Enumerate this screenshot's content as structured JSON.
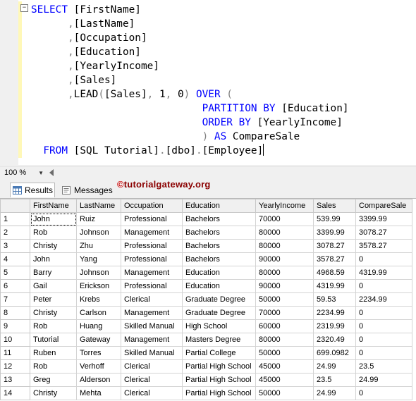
{
  "editor": {
    "collapse_glyph": "−",
    "lines": [
      [
        {
          "t": "SELECT ",
          "c": "kw"
        },
        {
          "t": "[FirstName]",
          "c": ""
        }
      ],
      [
        {
          "t": "      ",
          "c": ""
        },
        {
          "t": ",",
          "c": "gr"
        },
        {
          "t": "[LastName]",
          "c": ""
        }
      ],
      [
        {
          "t": "      ",
          "c": ""
        },
        {
          "t": ",",
          "c": "gr"
        },
        {
          "t": "[Occupation]",
          "c": ""
        }
      ],
      [
        {
          "t": "      ",
          "c": ""
        },
        {
          "t": ",",
          "c": "gr"
        },
        {
          "t": "[Education]",
          "c": ""
        }
      ],
      [
        {
          "t": "      ",
          "c": ""
        },
        {
          "t": ",",
          "c": "gr"
        },
        {
          "t": "[YearlyIncome]",
          "c": ""
        }
      ],
      [
        {
          "t": "      ",
          "c": ""
        },
        {
          "t": ",",
          "c": "gr"
        },
        {
          "t": "[Sales]",
          "c": ""
        }
      ],
      [
        {
          "t": "      ",
          "c": ""
        },
        {
          "t": ",",
          "c": "gr"
        },
        {
          "t": "LEAD",
          "c": ""
        },
        {
          "t": "(",
          "c": "gr"
        },
        {
          "t": "[Sales]",
          "c": ""
        },
        {
          "t": ", ",
          "c": "gr"
        },
        {
          "t": "1",
          "c": ""
        },
        {
          "t": ", ",
          "c": "gr"
        },
        {
          "t": "0",
          "c": ""
        },
        {
          "t": ") ",
          "c": "gr"
        },
        {
          "t": "OVER ",
          "c": "kw"
        },
        {
          "t": "(",
          "c": "gr"
        }
      ],
      [
        {
          "t": "                            ",
          "c": ""
        },
        {
          "t": "PARTITION BY ",
          "c": "kw"
        },
        {
          "t": "[Education]",
          "c": ""
        }
      ],
      [
        {
          "t": "                            ",
          "c": ""
        },
        {
          "t": "ORDER BY ",
          "c": "kw"
        },
        {
          "t": "[YearlyIncome]",
          "c": ""
        }
      ],
      [
        {
          "t": "                            ",
          "c": ""
        },
        {
          "t": ") ",
          "c": "gr"
        },
        {
          "t": "AS ",
          "c": "kw"
        },
        {
          "t": "CompareSale",
          "c": ""
        }
      ],
      [
        {
          "t": "  ",
          "c": ""
        },
        {
          "t": "FROM ",
          "c": "kw"
        },
        {
          "t": "[SQL Tutorial]",
          "c": ""
        },
        {
          "t": ".",
          "c": "gr"
        },
        {
          "t": "[dbo]",
          "c": ""
        },
        {
          "t": ".",
          "c": "gr"
        },
        {
          "t": "[Employee]",
          "c": ""
        }
      ]
    ]
  },
  "zoom": {
    "value": "100 %",
    "arrow": "▼"
  },
  "tabs": {
    "results": "Results",
    "messages": "Messages"
  },
  "watermark": {
    "symbol": "©",
    "text": "tutorialgateway.org"
  },
  "grid": {
    "columns": [
      "",
      "FirstName",
      "LastName",
      "Occupation",
      "Education",
      "YearlyIncome",
      "Sales",
      "CompareSale"
    ],
    "rows": [
      [
        "1",
        "John",
        "Ruiz",
        "Professional",
        "Bachelors",
        "70000",
        "539.99",
        "3399.99"
      ],
      [
        "2",
        "Rob",
        "Johnson",
        "Management",
        "Bachelors",
        "80000",
        "3399.99",
        "3078.27"
      ],
      [
        "3",
        "Christy",
        "Zhu",
        "Professional",
        "Bachelors",
        "80000",
        "3078.27",
        "3578.27"
      ],
      [
        "4",
        "John",
        "Yang",
        "Professional",
        "Bachelors",
        "90000",
        "3578.27",
        "0"
      ],
      [
        "5",
        "Barry",
        "Johnson",
        "Management",
        "Education",
        "80000",
        "4968.59",
        "4319.99"
      ],
      [
        "6",
        "Gail",
        "Erickson",
        "Professional",
        "Education",
        "90000",
        "4319.99",
        "0"
      ],
      [
        "7",
        "Peter",
        "Krebs",
        "Clerical",
        "Graduate Degree",
        "50000",
        "59.53",
        "2234.99"
      ],
      [
        "8",
        "Christy",
        "Carlson",
        "Management",
        "Graduate Degree",
        "70000",
        "2234.99",
        "0"
      ],
      [
        "9",
        "Rob",
        "Huang",
        "Skilled Manual",
        "High School",
        "60000",
        "2319.99",
        "0"
      ],
      [
        "10",
        "Tutorial",
        "Gateway",
        "Management",
        "Masters Degree",
        "80000",
        "2320.49",
        "0"
      ],
      [
        "11",
        "Ruben",
        "Torres",
        "Skilled Manual",
        "Partial College",
        "50000",
        "699.0982",
        "0"
      ],
      [
        "12",
        "Rob",
        "Verhoff",
        "Clerical",
        "Partial High School",
        "45000",
        "24.99",
        "23.5"
      ],
      [
        "13",
        "Greg",
        "Alderson",
        "Clerical",
        "Partial High School",
        "45000",
        "23.5",
        "24.99"
      ],
      [
        "14",
        "Christy",
        "Mehta",
        "Clerical",
        "Partial High School",
        "50000",
        "24.99",
        "0"
      ]
    ]
  }
}
